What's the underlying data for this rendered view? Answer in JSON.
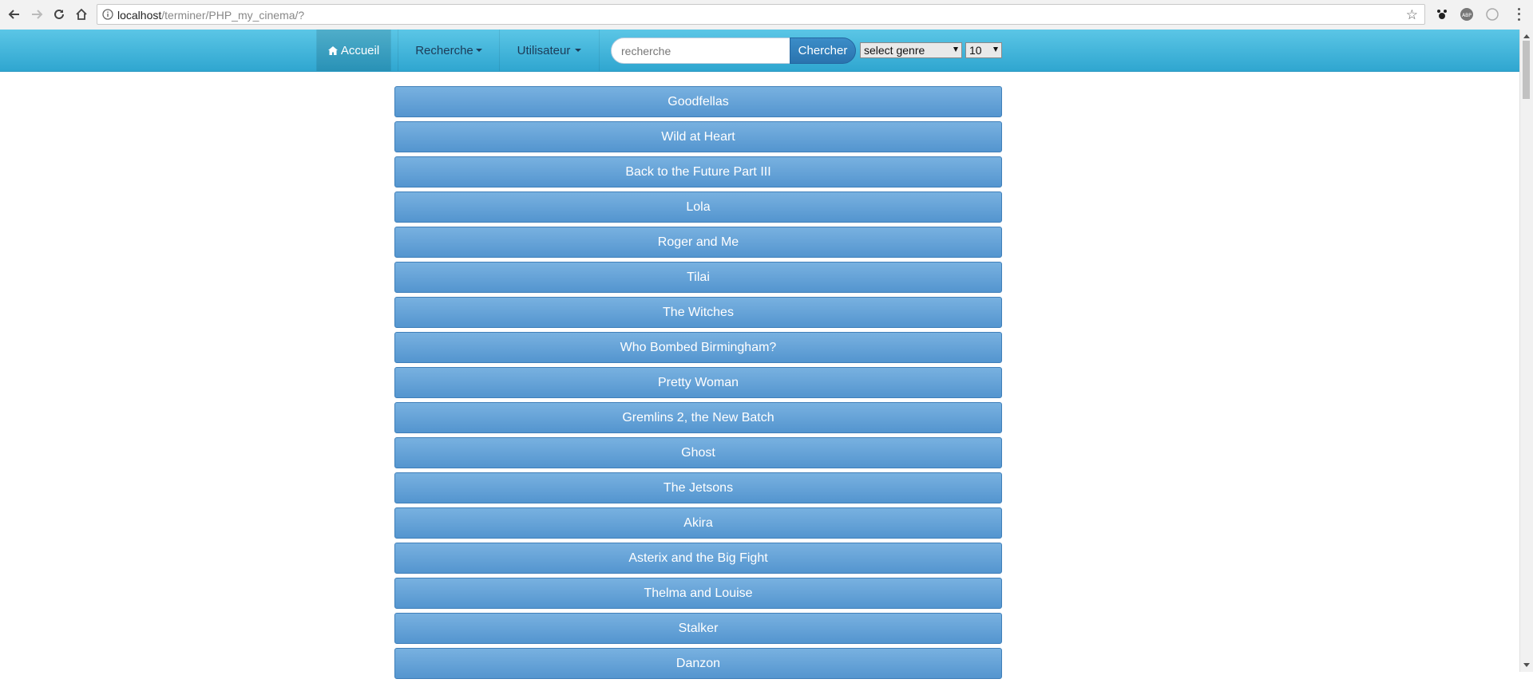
{
  "browser": {
    "url_host": "localhost",
    "url_path": "/terminer/PHP_my_cinema/?"
  },
  "navbar": {
    "home_label": "Accueil",
    "recherche_label": "Recherche",
    "utilisateur_label": "Utilisateur",
    "search_placeholder": "recherche",
    "search_button": "Chercher",
    "genre_select": "select genre",
    "count_select": "10"
  },
  "films": [
    "Goodfellas",
    "Wild at Heart",
    "Back to the Future Part III",
    "Lola",
    "Roger and Me",
    "Tilai",
    "The Witches",
    "Who Bombed Birmingham?",
    "Pretty Woman",
    "Gremlins 2, the New Batch",
    "Ghost",
    "The Jetsons",
    "Akira",
    "Asterix and the Big Fight",
    "Thelma and Louise",
    "Stalker",
    "Danzon"
  ],
  "colors": {
    "navbar": "#3bb4dc",
    "film_button": "#6aa6d9",
    "search_button": "#2f7dbb"
  }
}
